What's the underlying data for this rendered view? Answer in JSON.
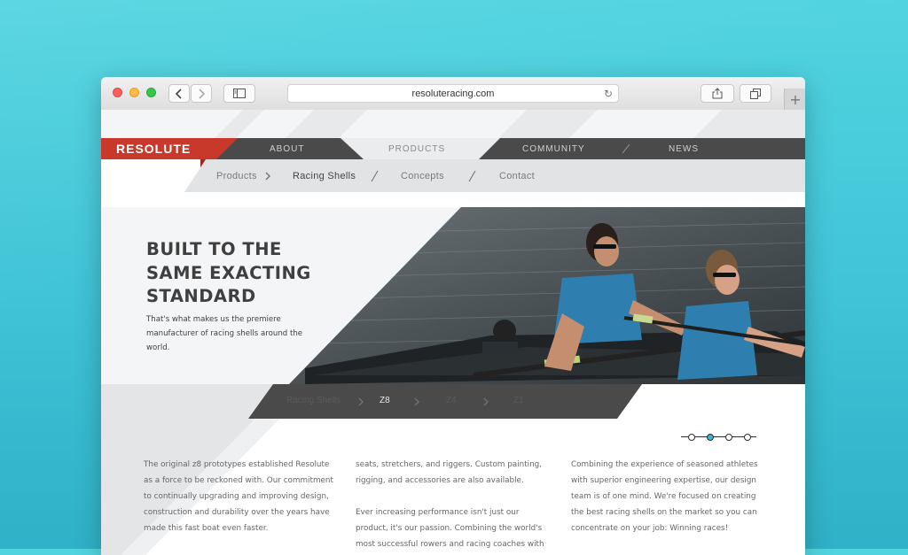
{
  "browser": {
    "url": "resoluteracing.com"
  },
  "site": {
    "logo": "RESOLUTE",
    "nav": [
      "ABOUT",
      "PRODUCTS",
      "COMMUNITY",
      "NEWS"
    ],
    "subnav": [
      "Products",
      "Racing Shells",
      "Concepts",
      "Contact"
    ]
  },
  "hero": {
    "title_lines": [
      "BUILT TO THE",
      "SAME EXACTING",
      "STANDARD"
    ],
    "lede": "That's what makes us the premiere manufacturer of racing shells around the world."
  },
  "strip": {
    "items": [
      "Racing Shells",
      "Z8",
      "Z4",
      "Z1"
    ],
    "active_index": 1
  },
  "carousel": {
    "dots": 4,
    "active_index": 1
  },
  "body": {
    "col1": "The original z8 prototypes established Resolute as a force to be reckoned with. Our commitment to continually upgrading and improving design, construction and durability over the years have made this fast boat even faster.",
    "col2_p1": "seats, stretchers, and riggers. Custom painting, rigging, and accessories are also available.",
    "col2_p2": "Ever increasing performance isn't just our product, it's our passion. Combining the world's most successful rowers and racing coaches with",
    "col3": "Combining the experience of seasoned athletes with superior engineering expertise, our design team is of one mind. We're focused on creating the best racing shells on the market so you can concentrate on your job: Winning races!"
  },
  "colors": {
    "brand_red": "#c8392b",
    "nav_dark": "#4a4a4a",
    "accent_teal": "#3bb6cf"
  }
}
